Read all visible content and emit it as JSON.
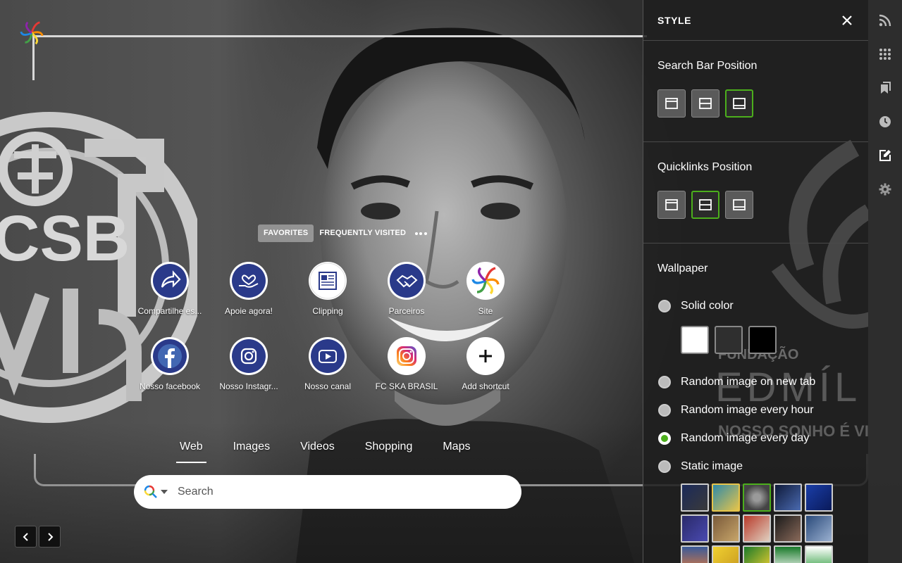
{
  "quicklinks": {
    "tabs": [
      {
        "label": "FAVORITES",
        "active": true
      },
      {
        "label": "FREQUENTLY VISITED",
        "active": false
      }
    ],
    "items": [
      {
        "label": "Compartilhe es...",
        "icon": "share-arrow-icon"
      },
      {
        "label": "Apoie agora!",
        "icon": "heart-hand-icon"
      },
      {
        "label": "Clipping",
        "icon": "newspaper-icon"
      },
      {
        "label": "Parceiros",
        "icon": "handshake-icon"
      },
      {
        "label": "Site",
        "icon": "colorful-spiral-logo-icon"
      },
      {
        "label": "Nosso facebook",
        "icon": "facebook-icon"
      },
      {
        "label": "Nosso Instagr...",
        "icon": "instagram-icon"
      },
      {
        "label": "Nosso canal",
        "icon": "youtube-icon"
      },
      {
        "label": "FC SKA BRASIL",
        "icon": "instagram-gradient-icon"
      },
      {
        "label": "Add shortcut",
        "icon": "plus-icon"
      }
    ]
  },
  "search": {
    "tabs": [
      {
        "label": "Web",
        "active": true
      },
      {
        "label": "Images",
        "active": false
      },
      {
        "label": "Videos",
        "active": false
      },
      {
        "label": "Shopping",
        "active": false
      },
      {
        "label": "Maps",
        "active": false
      }
    ],
    "placeholder": "Search"
  },
  "style_panel": {
    "title": "STYLE",
    "search_bar_position": {
      "title": "Search Bar Position",
      "selected": 3
    },
    "quicklinks_position": {
      "title": "Quicklinks Position",
      "selected": 2
    },
    "wallpaper": {
      "title": "Wallpaper",
      "options": [
        {
          "label": "Solid color",
          "checked": false
        },
        {
          "label": "Random image on new tab",
          "checked": false
        },
        {
          "label": "Random image every hour",
          "checked": false
        },
        {
          "label": "Random image every day",
          "checked": true
        },
        {
          "label": "Static image",
          "checked": false
        }
      ],
      "swatches": [
        "#ffffff",
        "#2f2f2f",
        "#000000"
      ]
    }
  },
  "wallpaper_art": {
    "emblem_text": "CSB",
    "overlay_line1": "FUNDAÇÃO",
    "overlay_line2": "EDMÍL",
    "overlay_line3": "NOSSO SONHO É VI"
  },
  "colors": {
    "accent_green": "#4caf1c",
    "icon_navy": "#2a3a8a"
  }
}
